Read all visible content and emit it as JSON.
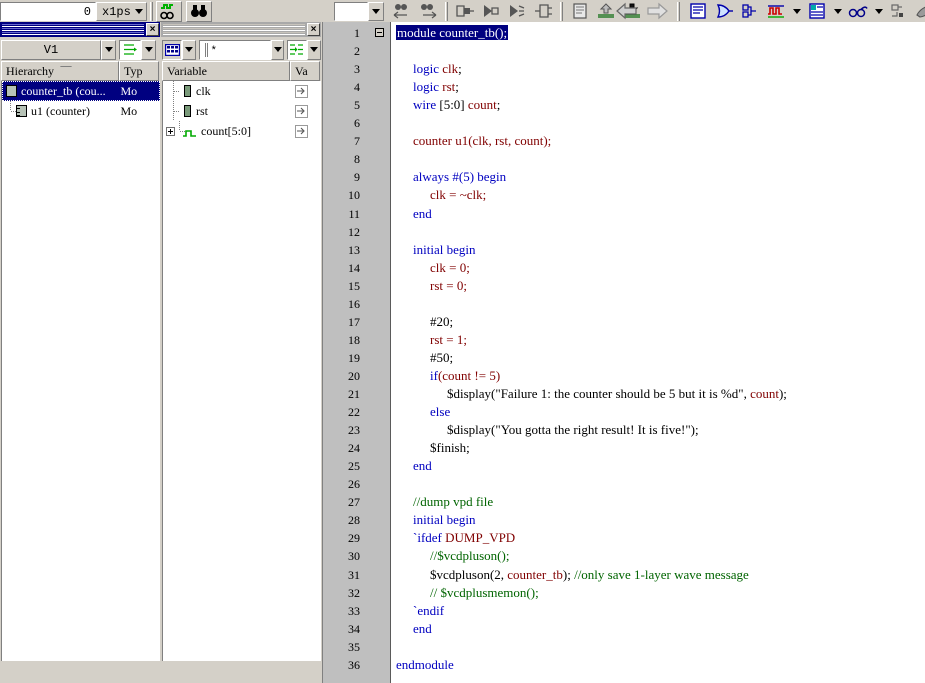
{
  "toolbar": {
    "time_value": "0",
    "time_unit": "x1ps",
    "buttons": [
      {
        "name": "search-signal-icon",
        "label": "Search Signal"
      },
      {
        "name": "binoculars-icon",
        "label": "Find"
      },
      {
        "name": "prev-history-icon",
        "label": "Back"
      },
      {
        "name": "next-history-icon",
        "label": "Forward"
      },
      {
        "name": "compare-icon",
        "label": "Compare"
      },
      {
        "name": "expand-bus-icon",
        "label": "Expand Bus"
      },
      {
        "name": "collapse-bus-icon",
        "label": "Collapse Bus"
      },
      {
        "name": "group-signal-icon",
        "label": "Group Signals"
      },
      {
        "name": "list-view-icon",
        "label": "List"
      },
      {
        "name": "load-up-icon",
        "label": "Load Up"
      },
      {
        "name": "load-down-icon",
        "label": "Load Down"
      },
      {
        "name": "left-arrow-icon",
        "label": "Previous"
      },
      {
        "name": "right-arrow-icon",
        "label": "Next"
      },
      {
        "name": "source-view-icon",
        "label": "Source"
      },
      {
        "name": "schematic-icon",
        "label": "Schematic"
      },
      {
        "name": "path-schematic-icon",
        "label": "Path Schematic"
      },
      {
        "name": "wave-view-icon",
        "label": "Wave"
      },
      {
        "name": "list-window-icon",
        "label": "List Window"
      },
      {
        "name": "assertion-icon",
        "label": "Assertion"
      },
      {
        "name": "memory-icon",
        "label": "Memory"
      },
      {
        "name": "coverage-icon",
        "label": "Coverage"
      },
      {
        "name": "stack-icon",
        "label": "Stack"
      }
    ]
  },
  "hierarchy_panel": {
    "title": "",
    "close_label": "×",
    "scope_value": "V1",
    "filter_icon": "hierarchy-filter-icon",
    "columns": [
      "Hierarchy",
      "Typ"
    ],
    "rows": [
      {
        "name": "counter_tb (cou...",
        "type": "Mo",
        "selected": true,
        "depth": 0,
        "icon": "module-icon"
      },
      {
        "name": "u1 (counter)",
        "type": "Mo",
        "selected": false,
        "depth": 1,
        "icon": "instance-icon"
      }
    ]
  },
  "variable_panel": {
    "title": "",
    "close_label": "×",
    "filter_value": "*",
    "view_icon": "table-view-icon",
    "columns": [
      "Variable",
      "Va"
    ],
    "rows": [
      {
        "name": "clk",
        "icon": "signal-icon",
        "expandable": false,
        "last": false
      },
      {
        "name": "rst",
        "icon": "signal-icon",
        "expandable": false,
        "last": false
      },
      {
        "name": "count[5:0]",
        "icon": "bus-icon",
        "expandable": true,
        "last": true
      }
    ]
  },
  "source_view": {
    "first_line_collapsible": true,
    "lines": [
      {
        "n": 1,
        "indent": 0,
        "selected": true,
        "tokens": [
          {
            "t": "module ",
            "c": "kw"
          },
          {
            "t": "counter_tb();",
            "c": "pl"
          }
        ]
      },
      {
        "n": 2,
        "indent": 0,
        "tokens": []
      },
      {
        "n": 3,
        "indent": 1,
        "tokens": [
          {
            "t": "logic ",
            "c": "kw"
          },
          {
            "t": "clk",
            "c": "id"
          },
          {
            "t": ";",
            "c": "pl"
          }
        ]
      },
      {
        "n": 4,
        "indent": 1,
        "tokens": [
          {
            "t": "logic ",
            "c": "kw"
          },
          {
            "t": "rst",
            "c": "id"
          },
          {
            "t": ";",
            "c": "pl"
          }
        ]
      },
      {
        "n": 5,
        "indent": 1,
        "tokens": [
          {
            "t": "wire ",
            "c": "kw"
          },
          {
            "t": "[5:0] ",
            "c": "pl"
          },
          {
            "t": "count",
            "c": "id"
          },
          {
            "t": ";",
            "c": "pl"
          }
        ]
      },
      {
        "n": 6,
        "indent": 0,
        "tokens": []
      },
      {
        "n": 7,
        "indent": 1,
        "tokens": [
          {
            "t": "counter u1(clk, rst, count);",
            "c": "id"
          }
        ]
      },
      {
        "n": 8,
        "indent": 0,
        "tokens": []
      },
      {
        "n": 9,
        "indent": 1,
        "tokens": [
          {
            "t": "always ",
            "c": "kw"
          },
          {
            "t": "#(5) ",
            "c": "kw"
          },
          {
            "t": "begin",
            "c": "kw"
          }
        ]
      },
      {
        "n": 10,
        "indent": 2,
        "tokens": [
          {
            "t": "clk = ~clk;",
            "c": "id"
          }
        ]
      },
      {
        "n": 11,
        "indent": 1,
        "tokens": [
          {
            "t": "end",
            "c": "kw"
          }
        ]
      },
      {
        "n": 12,
        "indent": 0,
        "tokens": []
      },
      {
        "n": 13,
        "indent": 1,
        "tokens": [
          {
            "t": "initial begin",
            "c": "kw"
          }
        ]
      },
      {
        "n": 14,
        "indent": 2,
        "tokens": [
          {
            "t": "clk",
            "c": "id"
          },
          {
            "t": " = 0;",
            "c": "id"
          }
        ]
      },
      {
        "n": 15,
        "indent": 2,
        "tokens": [
          {
            "t": "rst",
            "c": "id"
          },
          {
            "t": " = 0;",
            "c": "id"
          }
        ]
      },
      {
        "n": 16,
        "indent": 0,
        "tokens": []
      },
      {
        "n": 17,
        "indent": 2,
        "tokens": [
          {
            "t": "#20;",
            "c": "pl"
          }
        ]
      },
      {
        "n": 18,
        "indent": 2,
        "tokens": [
          {
            "t": "rst",
            "c": "id"
          },
          {
            "t": " = 1;",
            "c": "id"
          }
        ]
      },
      {
        "n": 19,
        "indent": 2,
        "tokens": [
          {
            "t": "#50;",
            "c": "pl"
          }
        ]
      },
      {
        "n": 20,
        "indent": 2,
        "tokens": [
          {
            "t": "if",
            "c": "kw"
          },
          {
            "t": "(count != 5)",
            "c": "id"
          }
        ]
      },
      {
        "n": 21,
        "indent": 3,
        "tokens": [
          {
            "t": "$display(\"Failure 1: the counter should be 5 but it is %d\", ",
            "c": "pl"
          },
          {
            "t": "count",
            "c": "id"
          },
          {
            "t": ");",
            "c": "pl"
          }
        ]
      },
      {
        "n": 22,
        "indent": 2,
        "tokens": [
          {
            "t": "else",
            "c": "kw"
          }
        ]
      },
      {
        "n": 23,
        "indent": 3,
        "tokens": [
          {
            "t": "$display(\"You gotta the right result! It is five!\");",
            "c": "pl"
          }
        ]
      },
      {
        "n": 24,
        "indent": 2,
        "tokens": [
          {
            "t": "$finish;",
            "c": "pl"
          }
        ]
      },
      {
        "n": 25,
        "indent": 1,
        "tokens": [
          {
            "t": "end",
            "c": "kw"
          }
        ]
      },
      {
        "n": 26,
        "indent": 0,
        "tokens": []
      },
      {
        "n": 27,
        "indent": 1,
        "tokens": [
          {
            "t": "//dump vpd file",
            "c": "cm"
          }
        ]
      },
      {
        "n": 28,
        "indent": 1,
        "tokens": [
          {
            "t": "initial begin",
            "c": "kw"
          }
        ]
      },
      {
        "n": 29,
        "indent": 1,
        "tokens": [
          {
            "t": "`ifdef ",
            "c": "kw"
          },
          {
            "t": "DUMP_VPD",
            "c": "id"
          }
        ]
      },
      {
        "n": 30,
        "indent": 2,
        "tokens": [
          {
            "t": "//$vcdpluson();",
            "c": "cm"
          }
        ]
      },
      {
        "n": 31,
        "indent": 2,
        "tokens": [
          {
            "t": "$vcdpluson(2, ",
            "c": "pl"
          },
          {
            "t": "counter_tb",
            "c": "id"
          },
          {
            "t": "); ",
            "c": "pl"
          },
          {
            "t": "//only save 1-layer wave message",
            "c": "cm"
          }
        ]
      },
      {
        "n": 32,
        "indent": 2,
        "tokens": [
          {
            "t": "// $vcdplusmemon();",
            "c": "cm"
          }
        ]
      },
      {
        "n": 33,
        "indent": 1,
        "tokens": [
          {
            "t": "`endif",
            "c": "kw"
          }
        ]
      },
      {
        "n": 34,
        "indent": 1,
        "tokens": [
          {
            "t": "end",
            "c": "kw"
          }
        ]
      },
      {
        "n": 35,
        "indent": 0,
        "tokens": []
      },
      {
        "n": 36,
        "indent": 0,
        "tokens": [
          {
            "t": "endmodule",
            "c": "kw"
          }
        ]
      }
    ]
  },
  "colors": {
    "keyword": "#0000c0",
    "identifier": "#800000",
    "comment": "#006400",
    "selection": "#000080",
    "chrome": "#d4d0c8"
  }
}
